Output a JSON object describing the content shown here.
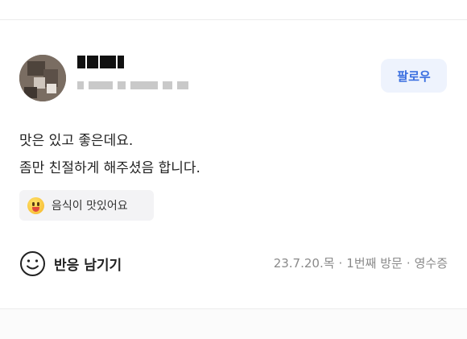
{
  "review": {
    "follow_label": "팔로우",
    "text_lines": [
      "맛은 있고 좋은데요.",
      "좀만 친절하게 해주셨음 합니다."
    ],
    "tag": {
      "icon": "yum-emoji-icon",
      "label": "음식이 맛있어요"
    },
    "reaction_label": "반응 남기기",
    "visit": {
      "date": "23.7.20.목",
      "visit_count": "1번째 방문",
      "proof": "영수증"
    }
  },
  "colors": {
    "accent": "#3a6fe0",
    "follow_bg": "#eef3fd",
    "tag_bg": "#f3f3f5",
    "meta_text": "#8a8a8a"
  }
}
